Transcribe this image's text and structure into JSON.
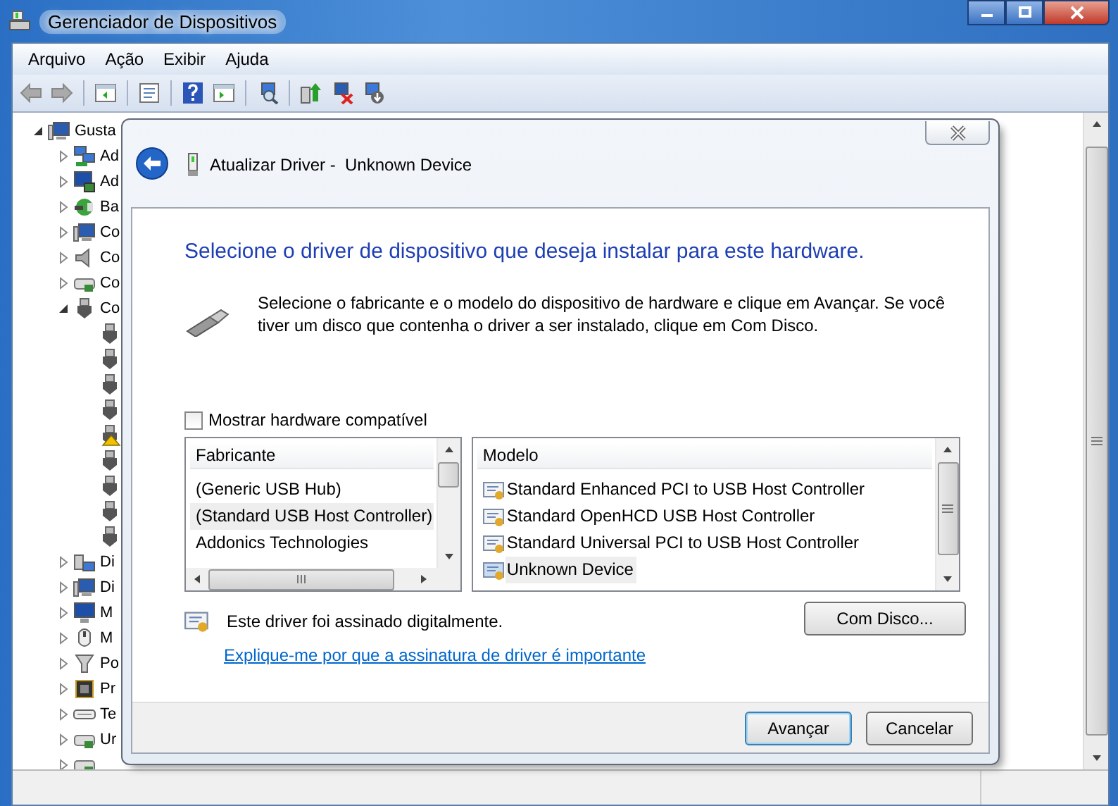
{
  "window": {
    "title": "Gerenciador de Dispositivos"
  },
  "menu": [
    {
      "label": "Arquivo"
    },
    {
      "label": "Ação"
    },
    {
      "label": "Exibir"
    },
    {
      "label": "Ajuda"
    }
  ],
  "tree": {
    "label": "Gusta",
    "kind": "computer",
    "expanded": true,
    "children": [
      {
        "label": "Ad",
        "kind": "network",
        "expanded": false
      },
      {
        "label": "Ad",
        "kind": "display",
        "expanded": false
      },
      {
        "label": "Ba",
        "kind": "battery",
        "expanded": false
      },
      {
        "label": "Co",
        "kind": "computer",
        "expanded": false
      },
      {
        "label": "Co",
        "kind": "speaker",
        "expanded": false
      },
      {
        "label": "Co",
        "kind": "controller",
        "expanded": false
      },
      {
        "label": "Co",
        "kind": "usb",
        "expanded": true,
        "children": [
          {
            "kind": "usb"
          },
          {
            "kind": "usb"
          },
          {
            "kind": "usb"
          },
          {
            "kind": "usb"
          },
          {
            "kind": "usb-warning"
          },
          {
            "kind": "usb"
          },
          {
            "kind": "usb"
          },
          {
            "kind": "usb"
          },
          {
            "kind": "usb"
          }
        ]
      },
      {
        "label": "Di",
        "kind": "drive",
        "expanded": false
      },
      {
        "label": "Di",
        "kind": "computer",
        "expanded": false
      },
      {
        "label": "M",
        "kind": "monitor",
        "expanded": false
      },
      {
        "label": "M",
        "kind": "mouse",
        "expanded": false
      },
      {
        "label": "Po",
        "kind": "port",
        "expanded": false
      },
      {
        "label": "Pr",
        "kind": "chip",
        "expanded": false
      },
      {
        "label": "Te",
        "kind": "keyboard",
        "expanded": false
      },
      {
        "label": "Ur",
        "kind": "controller",
        "expanded": false
      },
      {
        "kind": "controller",
        "expanded": false
      }
    ]
  },
  "dialog": {
    "title": "Atualizar Driver -  Unknown Device",
    "heading": "Selecione o driver de dispositivo que deseja instalar para este hardware.",
    "description": "Selecione o fabricante e o modelo do dispositivo de hardware e clique em Avançar. Se você tiver um disco que contenha o driver a ser instalado, clique em Com Disco.",
    "show_compatible": {
      "label": "Mostrar hardware compatível",
      "checked": false
    },
    "manufacturers": {
      "header": "Fabricante",
      "items": [
        {
          "label": "(Generic USB Hub)",
          "selected": false
        },
        {
          "label": "(Standard USB Host Controller)",
          "selected": true
        },
        {
          "label": "Addonics Technologies",
          "selected": false
        }
      ]
    },
    "models": {
      "header": "Modelo",
      "items": [
        {
          "label": "Standard Enhanced PCI to USB Host Controller",
          "selected": false
        },
        {
          "label": "Standard OpenHCD USB Host Controller",
          "selected": false
        },
        {
          "label": "Standard Universal PCI to USB Host Controller",
          "selected": false
        },
        {
          "label": "Unknown Device",
          "selected": true
        }
      ]
    },
    "signature": "Este driver foi assinado digitalmente.",
    "link": "Explique-me por que a assinatura de driver é importante",
    "have_disk": "Com Disco...",
    "buttons": [
      {
        "label": "Avançar",
        "default": true
      },
      {
        "label": "Cancelar",
        "default": false
      }
    ]
  }
}
